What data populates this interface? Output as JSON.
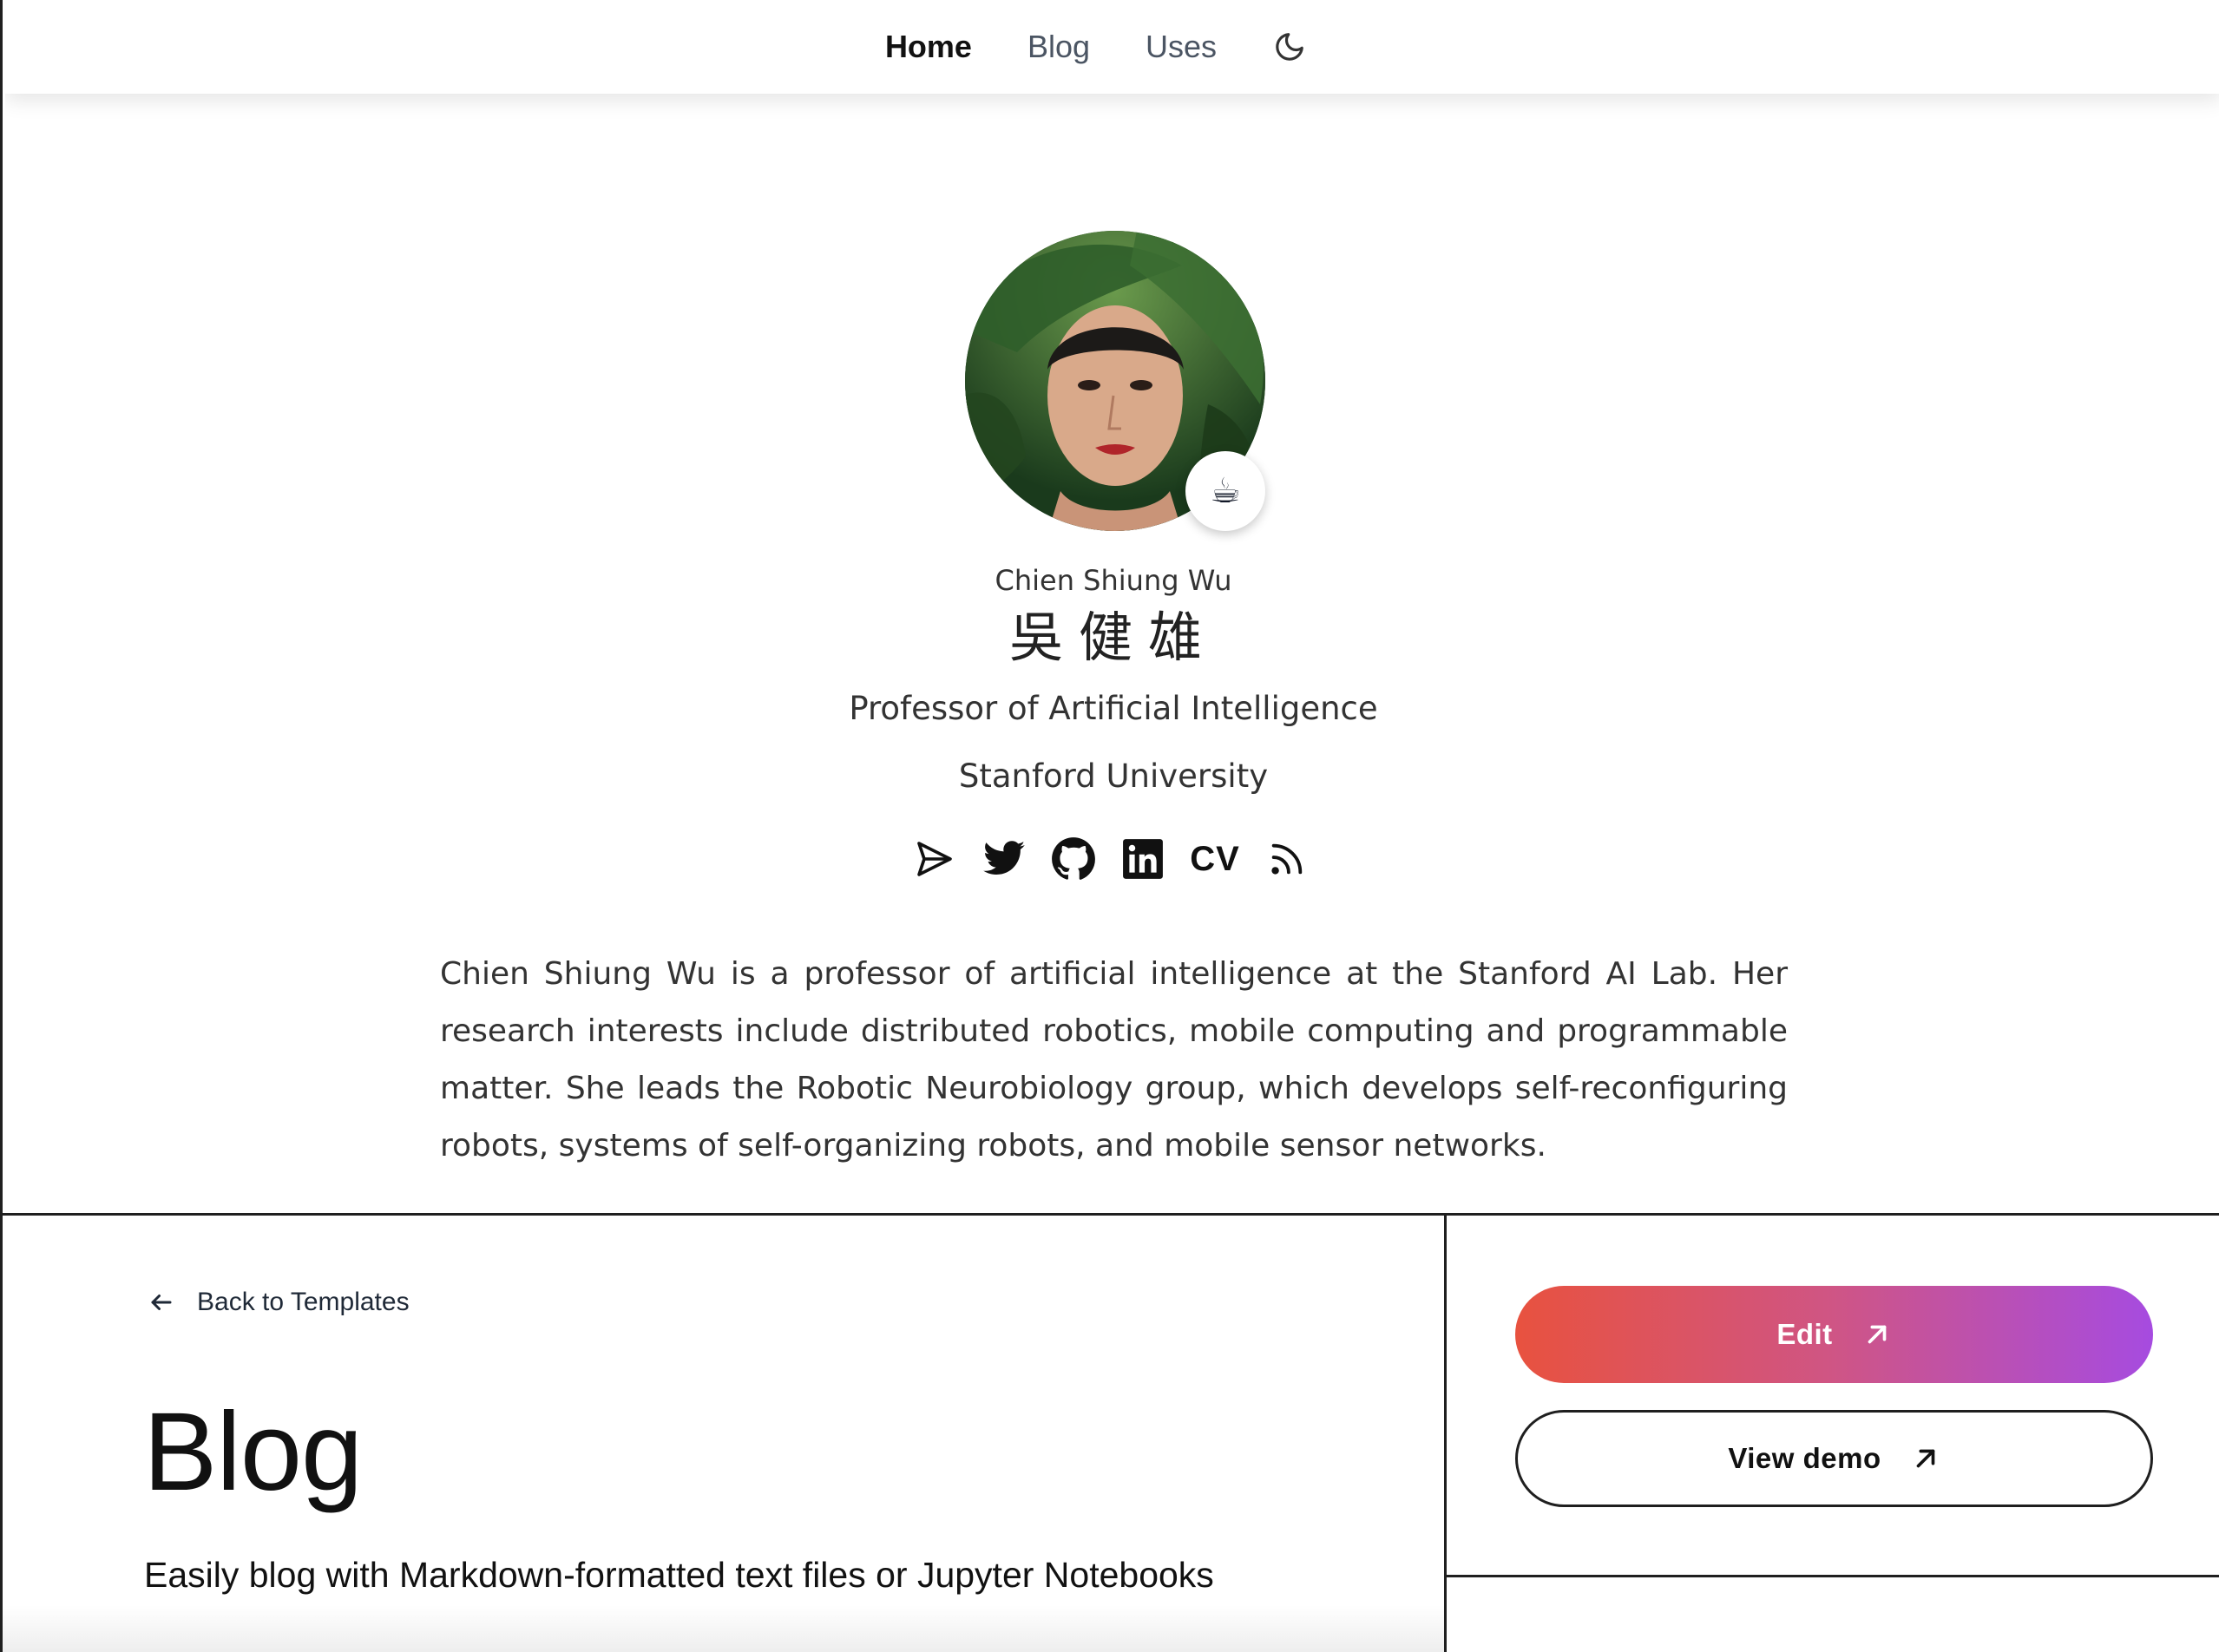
{
  "nav": {
    "items": [
      {
        "label": "Home",
        "active": true
      },
      {
        "label": "Blog",
        "active": false
      },
      {
        "label": "Uses",
        "active": false
      }
    ],
    "theme_icon": "moon-icon"
  },
  "profile": {
    "status_emoji": "☕",
    "name_latin": "Chien Shiung Wu",
    "name_han": "吳健雄",
    "role": "Professor of Artificial Intelligence",
    "institution": "Stanford University",
    "socials": [
      {
        "icon": "send-icon"
      },
      {
        "icon": "twitter-icon"
      },
      {
        "icon": "github-icon"
      },
      {
        "icon": "linkedin-icon"
      },
      {
        "icon": "cv-icon",
        "label": "CV"
      },
      {
        "icon": "rss-icon"
      }
    ],
    "bio": "Chien Shiung Wu is a professor of artificial intelligence at the Stanford AI Lab. Her research interests include distributed robotics, mobile computing and programmable matter. She leads the Robotic Neurobiology group, which develops self-reconfiguring robots, systems of self-organizing robots, and mobile sensor networks."
  },
  "template_panel": {
    "back_label": "Back to Templates",
    "title": "Blog",
    "subtitle": "Easily blog with Markdown-formatted text files or Jupyter Notebooks"
  },
  "actions": {
    "edit_label": "Edit",
    "demo_label": "View demo"
  },
  "colors": {
    "gradient_start": "#e8523f",
    "gradient_end": "#a64be0"
  }
}
